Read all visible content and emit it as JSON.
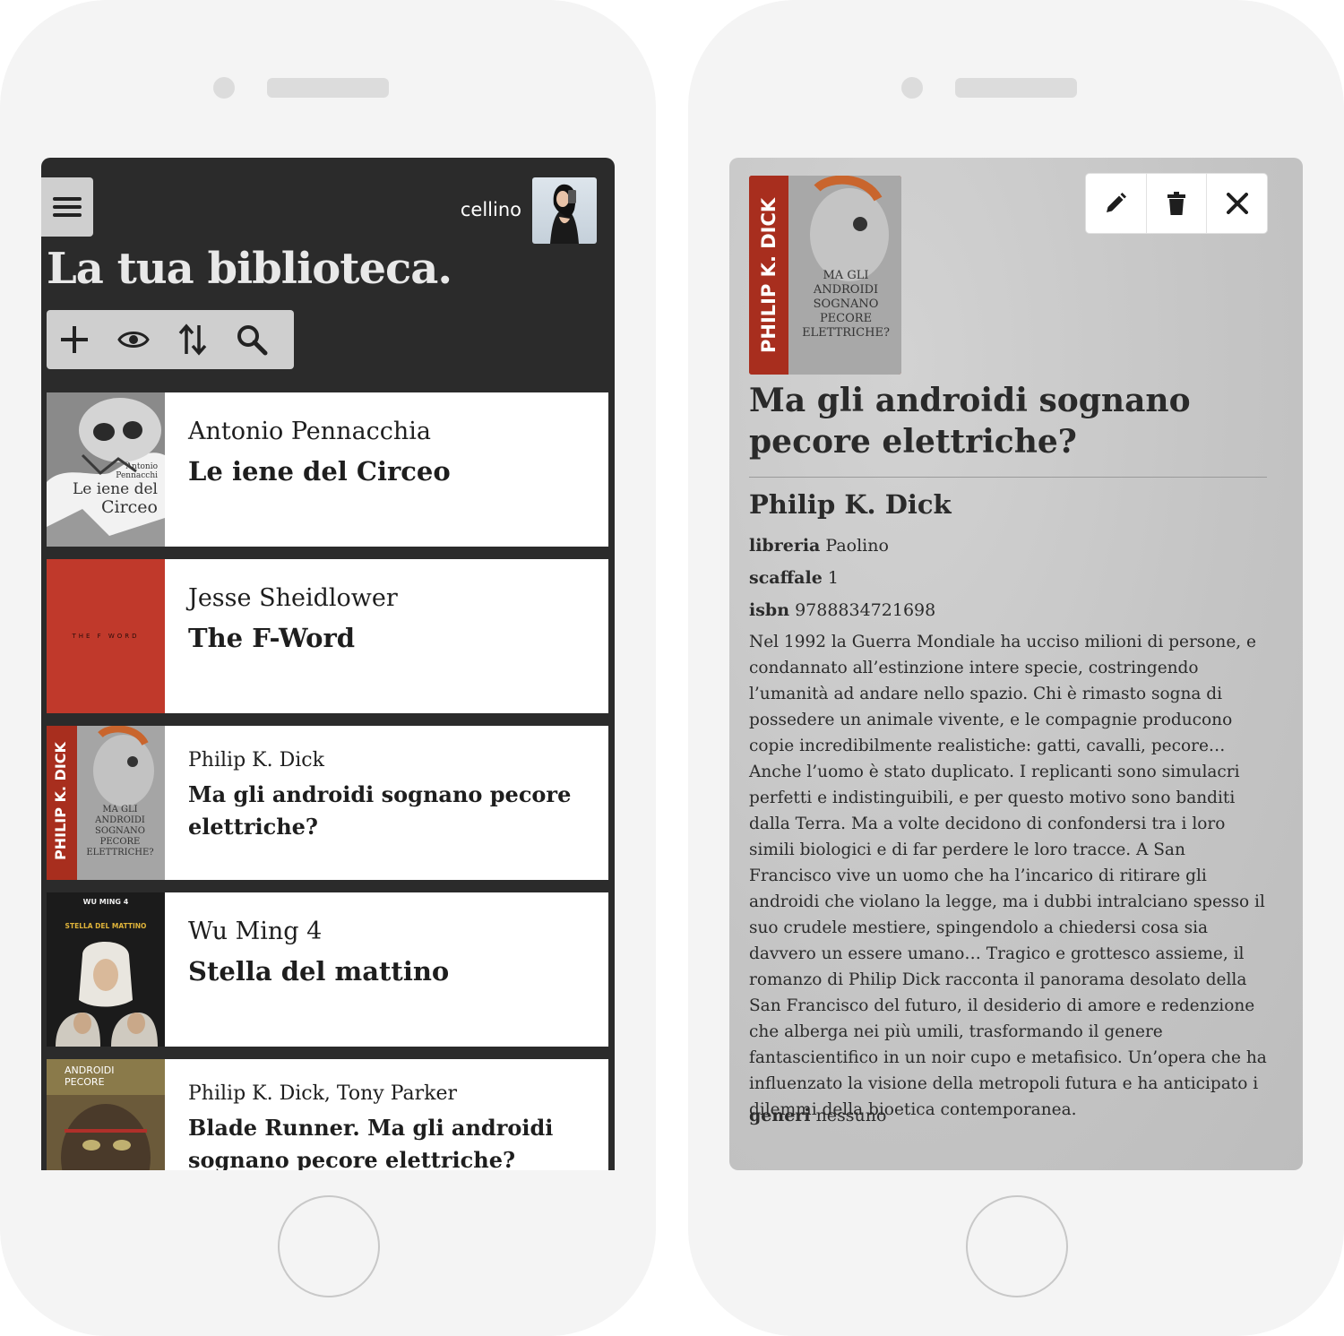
{
  "left_phone": {
    "header": {
      "username": "cellino",
      "title": "La tua biblioteca."
    },
    "toolbar": {
      "icons": [
        "plus-icon",
        "eye-icon",
        "sort-icon",
        "search-icon"
      ]
    },
    "books": [
      {
        "author": "Antonio Pennacchia",
        "title": "Le iene del Circeo",
        "cover_text": [
          "Antonio",
          "Pennacchi",
          "Le iene del",
          "Circeo"
        ]
      },
      {
        "author": "Jesse Sheidlower",
        "title": "The F-Word",
        "cover_text": "THE F WORD"
      },
      {
        "author": "Philip K. Dick",
        "title": "Ma gli androidi sognano pecore elettriche?",
        "cover_text": [
          "PHILIP K. DICK",
          "MA GLI",
          "ANDROIDI",
          "SOGNANO",
          "PECORE",
          "ELETTRICHE?"
        ]
      },
      {
        "author": "Wu Ming 4",
        "title": "Stella del mattino",
        "cover_text": [
          "WU MING 4",
          "STELLA DEL MATTINO"
        ]
      },
      {
        "author": "Philip K. Dick, Tony Parker",
        "title": "Blade Runner. Ma gli androidi sognano pecore elettriche?",
        "cover_text": [
          "ANDROIDI",
          "PECORE"
        ]
      }
    ]
  },
  "right_phone": {
    "detail": {
      "cover_text": [
        "PHILIP K. DICK",
        "MA GLI",
        "ANDROIDI",
        "SOGNANO",
        "PECORE",
        "ELETTRICHE?"
      ],
      "title": "Ma gli androidi sognano pecore elettriche?",
      "author": "Philip K. Dick",
      "libreria_label": "libreria",
      "libreria_value": "Paolino",
      "scaffale_label": "scaffale",
      "scaffale_value": "1",
      "isbn_label": "isbn",
      "isbn_value": "9788834721698",
      "description": "Nel 1992 la Guerra Mondiale ha ucciso milioni di persone, e condannato all’estinzione intere specie, costringendo l’umanità ad andare nello spazio. Chi è rimasto sogna di possedere un animale vivente, e le compagnie producono copie incredibilmente realistiche: gatti, cavalli, pecore… Anche l’uomo è stato duplicato. I replicanti sono simulacri perfetti e indistinguibili, e per questo motivo sono banditi dalla Terra. Ma a volte decidono di confondersi tra i loro simili biologici e di far perdere le loro tracce. A San Francisco vive un uomo che ha l’incarico di ritirare gli androidi che violano la legge, ma i dubbi intralciano spesso il suo crudele mestiere, spingendolo a chiedersi cosa sia davvero un essere umano… Tragico e grottesco assieme, il romanzo di Philip Dick racconta il panorama desolato della San Francisco del futuro, il desiderio di amore e redenzione che alberga nei più umili, trasformando il genere fantascientifico in un noir cupo e metafisico. Un’opera che ha influenzato la visione della metropoli futura e ha anticipato i dilemmi della bioetica contemporanea.",
      "generi_label": "generi",
      "generi_value": "nessuno"
    },
    "actions": [
      "edit-icon",
      "delete-icon",
      "close-icon"
    ]
  },
  "colors": {
    "screen_dark": "#2b2b2b",
    "card_bg": "#ffffff",
    "fword_red": "#c0392b",
    "detail_bg": "#c9c9c9"
  }
}
